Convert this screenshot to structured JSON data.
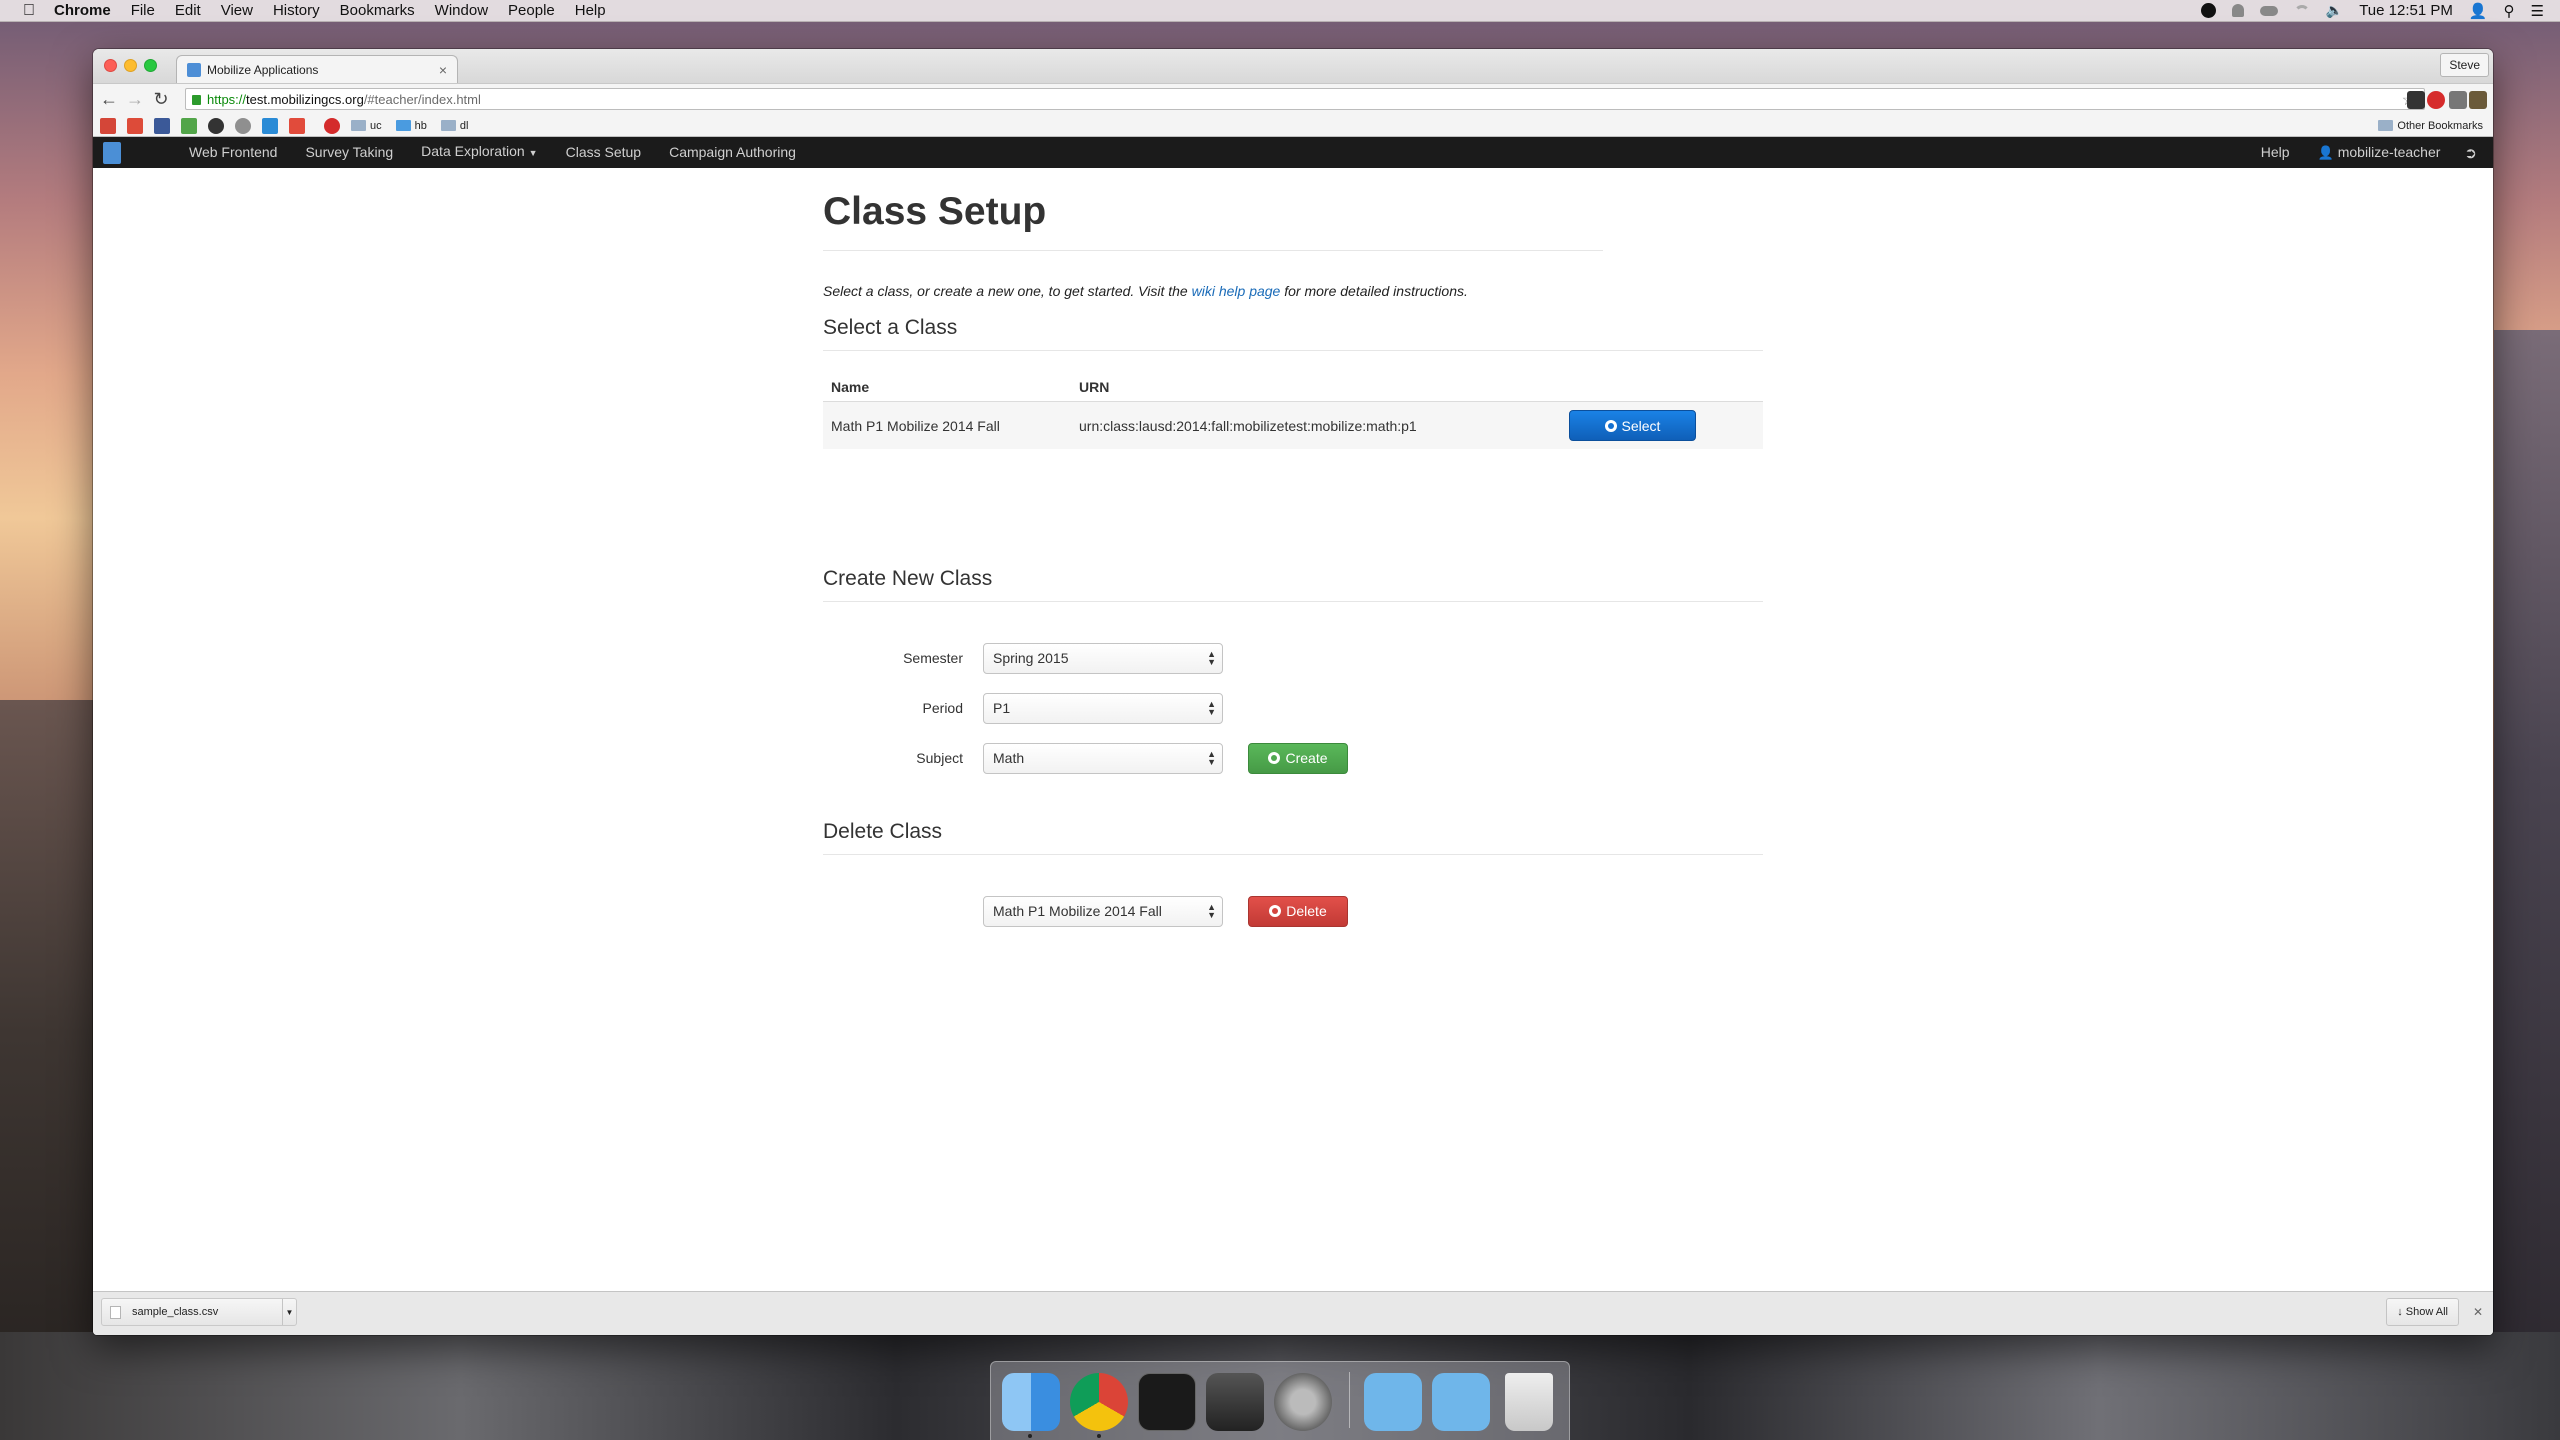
{
  "menubar": {
    "app_name": "Chrome",
    "menus": [
      "File",
      "Edit",
      "View",
      "History",
      "Bookmarks",
      "Window",
      "People",
      "Help"
    ],
    "clock": "Tue 12:51 PM"
  },
  "browser": {
    "tab_title": "Mobilize Applications",
    "tab_close": "×",
    "profile_name": "Steve",
    "url_scheme": "https://",
    "url_host": "test.mobilizingcs.org",
    "url_path": "/#teacher/index.html",
    "bookmark_folders": [
      "uc",
      "hb",
      "dl"
    ],
    "other_bookmarks": "Other Bookmarks"
  },
  "navbar": {
    "links": [
      "Web Frontend",
      "Survey Taking",
      "Data Exploration",
      "Class Setup",
      "Campaign Authoring"
    ],
    "help": "Help",
    "user": "mobilize-teacher"
  },
  "page": {
    "title": "Class Setup",
    "intro_before": "Select a class, or create a new one, to get started. Visit the ",
    "intro_link": "wiki help page",
    "intro_after": " for more detailed instructions."
  },
  "select_section": {
    "heading": "Select a Class",
    "columns": [
      "Name",
      "URN"
    ],
    "rows": [
      {
        "name": "Math P1 Mobilize 2014 Fall",
        "urn": "urn:class:lausd:2014:fall:mobilizetest:mobilize:math:p1",
        "action": "Select"
      }
    ]
  },
  "create_section": {
    "heading": "Create New Class",
    "semester_label": "Semester",
    "semester_value": "Spring 2015",
    "period_label": "Period",
    "period_value": "P1",
    "subject_label": "Subject",
    "subject_value": "Math",
    "create_label": "Create"
  },
  "delete_section": {
    "heading": "Delete Class",
    "class_value": "Math P1 Mobilize 2014 Fall",
    "delete_label": "Delete"
  },
  "download_shelf": {
    "file_name": "sample_class.csv",
    "show_all": "Show All"
  },
  "colors": {
    "navbar_bg": "#1b1b1b",
    "primary": "#1470d0",
    "success": "#4fa84f",
    "danger": "#d4453f",
    "link": "#1a6bb8"
  }
}
